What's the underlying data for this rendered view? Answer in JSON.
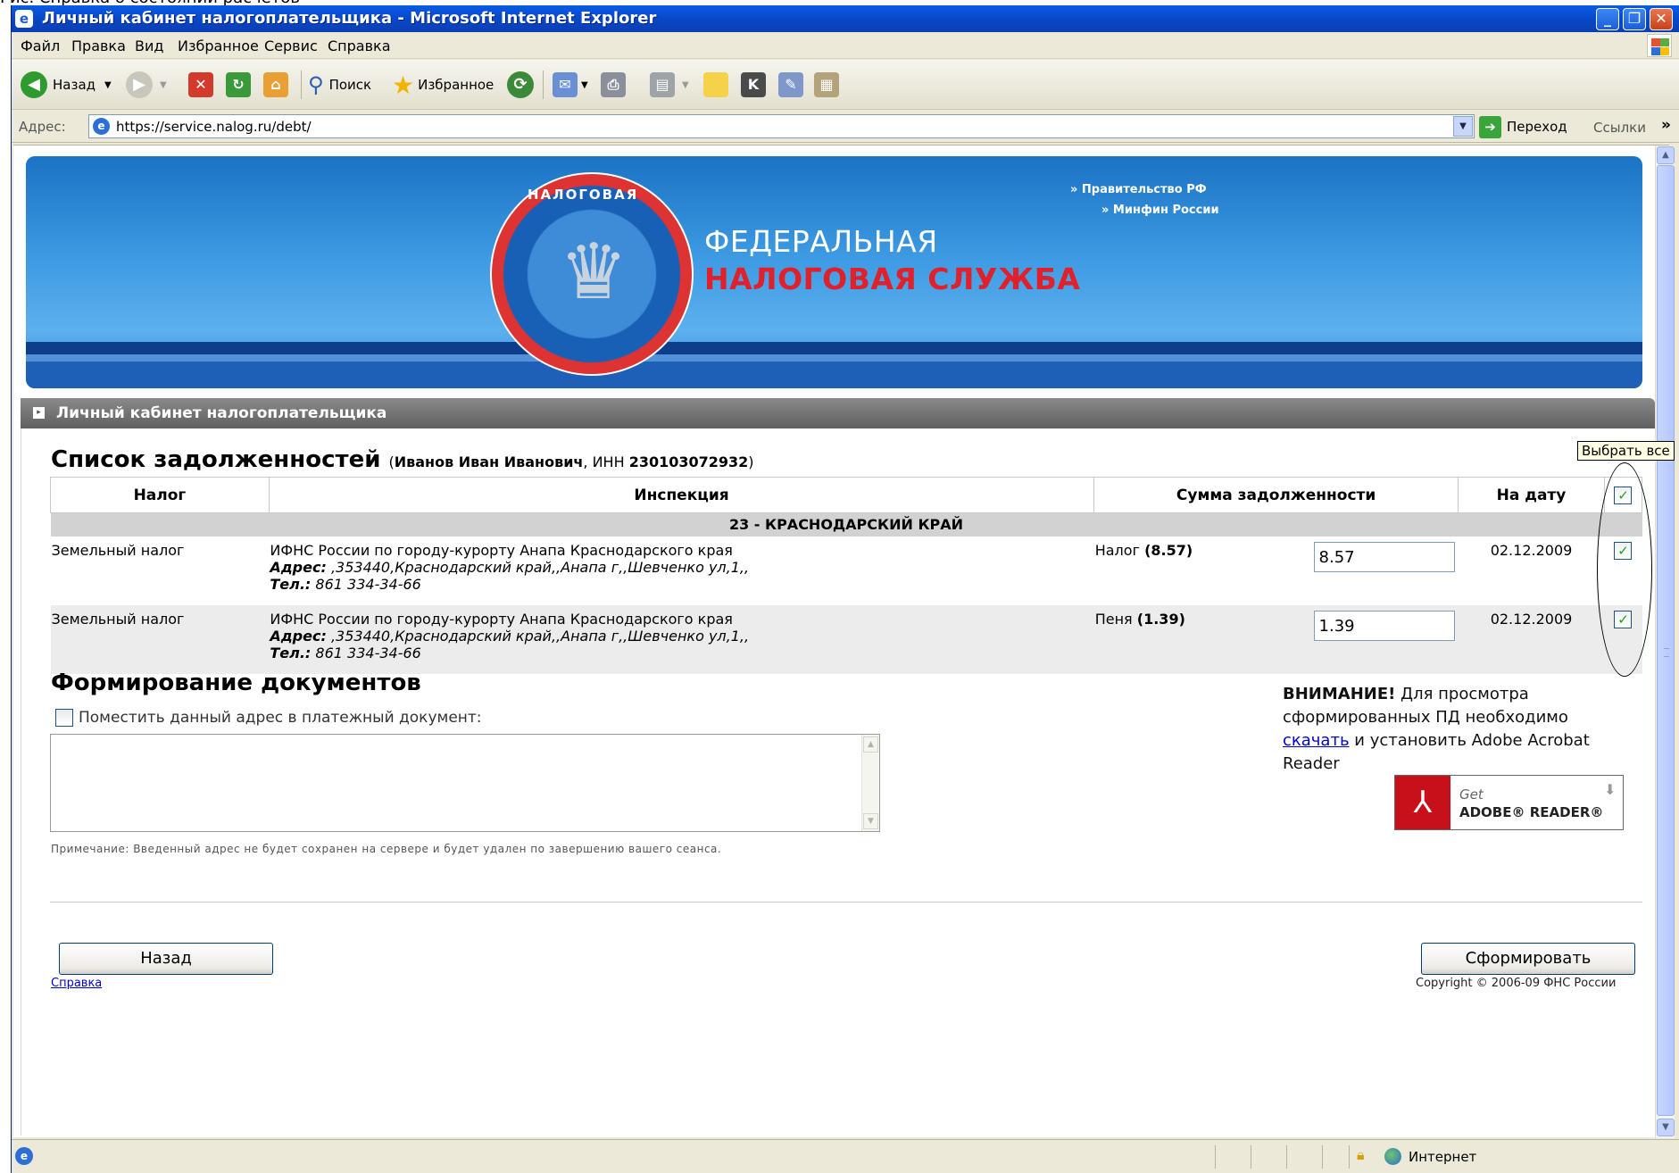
{
  "browser": {
    "title": "Личный кабинет налогоплательщика - Microsoft Internet Explorer",
    "menu": [
      "Файл",
      "Правка",
      "Вид",
      "Избранное",
      "Сервис",
      "Справка"
    ],
    "toolbar": {
      "back": "Назад",
      "search": "Поиск",
      "favorites": "Избранное"
    },
    "address_label": "Адрес:",
    "url": "https://service.nalog.ru/debt/",
    "go": "Переход",
    "links": "Ссылки",
    "status_zone": "Интернет"
  },
  "banner": {
    "line1": "ФЕДЕРАЛЬНАЯ",
    "line2": "НАЛОГОВАЯ СЛУЖБА",
    "emblem_text": "НАЛОГОВАЯ",
    "link1": "» Правительство РФ",
    "link2": "» Минфин России"
  },
  "section_title": "Личный кабинет налогоплательщика",
  "debts": {
    "title": "Список задолженностей",
    "person_name": "Иванов Иван Иванович",
    "inn_label": ", ИНН ",
    "inn": "230103072932",
    "columns": [
      "Налог",
      "Инспекция",
      "Сумма задолженности",
      "На дату"
    ],
    "region": "23 - КРАСНОДАРСКИЙ КРАЙ",
    "rows": [
      {
        "tax": "Земельный налог",
        "inspection": "ИФНС России по городу-курорту Анапа Краснодарского края",
        "address_label": "Адрес:",
        "address": " ,353440,Краснодарский край,,Анапа г,,Шевченко ул,1,,",
        "phone_label": "Тел.:",
        "phone": " 861 334-34-66",
        "kind": "Налог",
        "kind_amount": "(8.57)",
        "amount": "8.57",
        "date": "02.12.2009"
      },
      {
        "tax": "Земельный налог",
        "inspection": "ИФНС России по городу-курорту Анапа Краснодарского края",
        "address_label": "Адрес:",
        "address": " ,353440,Краснодарский край,,Анапа г,,Шевченко ул,1,,",
        "phone_label": "Тел.:",
        "phone": " 861 334-34-66",
        "kind": "Пеня",
        "kind_amount": "(1.39)",
        "amount": "1.39",
        "date": "02.12.2009"
      }
    ],
    "select_all_tooltip": "Выбрать все"
  },
  "docs": {
    "title": "Формирование документов",
    "checkbox_label": "Поместить данный адрес в платежный документ:",
    "note": "Примечание: Введенный адрес не будет сохранен на сервере и будет удален по завершению вашего сеанса."
  },
  "attention": {
    "bold": "ВНИМАНИЕ!",
    "text1": " Для просмотра сформированных ПД необходимо ",
    "link": "скачать",
    "text2": " и установить Adobe Acrobat Reader",
    "badge_get": "Get",
    "badge_name": "ADOBE® READER®"
  },
  "buttons": {
    "back": "Назад",
    "submit": "Сформировать"
  },
  "footer": {
    "help": "Справка",
    "copyright": "Copyright © 2006-09 ФНС России"
  }
}
